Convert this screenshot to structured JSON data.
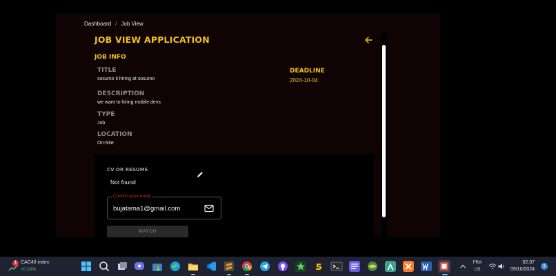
{
  "breadcrumb": {
    "home": "Dashboard",
    "separator": "/",
    "current": "Job View"
  },
  "page": {
    "title": "JOB VIEW APPLICATION",
    "section": "JOB INFO"
  },
  "job": {
    "title_label": "TITLE",
    "title_value": "sosumo it hiring at sosumo",
    "description_label": "DESCRIPTION",
    "description_value": "we want to hiring mobile devs",
    "type_label": "TYPE",
    "type_value": "Job",
    "location_label": "LOCATION",
    "location_value": "On-Site",
    "deadline_label": "DEADLINE",
    "deadline_value": "2024-10-04"
  },
  "cv": {
    "label": "CV OR RESUME",
    "value": "Not found",
    "email_legend": "Confirm your email",
    "email_value": "bujatama1@gmail.com",
    "match_label": "MATCH"
  },
  "taskbar": {
    "widget_badge": "1",
    "widget_title": "CAC40 index",
    "widget_change": "+0,16%",
    "lang_top": "FRA",
    "lang_bottom": "US",
    "time": "02:37",
    "date": "09/10/2024",
    "notifications": "1"
  },
  "colors": {
    "accent": "#f2c21a",
    "panel": "#100303",
    "error": "#d22c2c",
    "taskbar": "#1f2230"
  }
}
